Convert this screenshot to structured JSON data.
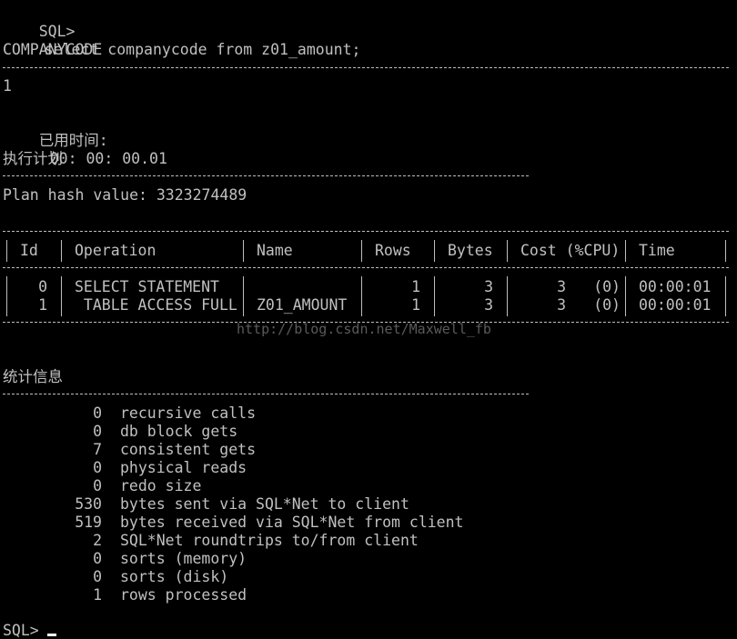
{
  "terminal": {
    "command_prompt": "SQL>",
    "command": "select companycode from z01_amount;",
    "result_header": "COMPANYCODE",
    "result_value": "1",
    "elapsed_label": "已用时间:",
    "elapsed_value": "00: 00: 00.01",
    "plan_heading": "执行计划",
    "plan_hash": "Plan hash value: 3323274489",
    "plan_table": {
      "headers": {
        "id": "Id",
        "operation": "Operation",
        "name": "Name",
        "rows": "Rows",
        "bytes": "Bytes",
        "cost": "Cost (%CPU)",
        "time": "Time"
      },
      "rows": [
        {
          "id": "0",
          "operation": "SELECT STATEMENT",
          "name": "",
          "rows": "1",
          "bytes": "3",
          "cost": "3",
          "cpu": "(0)",
          "time": "00:00:01"
        },
        {
          "id": "1",
          "operation": " TABLE ACCESS FULL",
          "name": "Z01_AMOUNT",
          "rows": "1",
          "bytes": "3",
          "cost": "3",
          "cpu": "(0)",
          "time": "00:00:01"
        }
      ]
    },
    "watermark": "http://blog.csdn.net/Maxwell_fb",
    "stats_heading": "统计信息",
    "stats": [
      {
        "value": "0",
        "label": "recursive calls"
      },
      {
        "value": "0",
        "label": "db block gets"
      },
      {
        "value": "7",
        "label": "consistent gets"
      },
      {
        "value": "0",
        "label": "physical reads"
      },
      {
        "value": "0",
        "label": "redo size"
      },
      {
        "value": "530",
        "label": "bytes sent via SQL*Net to client"
      },
      {
        "value": "519",
        "label": "bytes received via SQL*Net from client"
      },
      {
        "value": "2",
        "label": "SQL*Net roundtrips to/from client"
      },
      {
        "value": "0",
        "label": "sorts (memory)"
      },
      {
        "value": "0",
        "label": "sorts (disk)"
      },
      {
        "value": "1",
        "label": "rows processed"
      }
    ],
    "final_prompt": "SQL>"
  }
}
